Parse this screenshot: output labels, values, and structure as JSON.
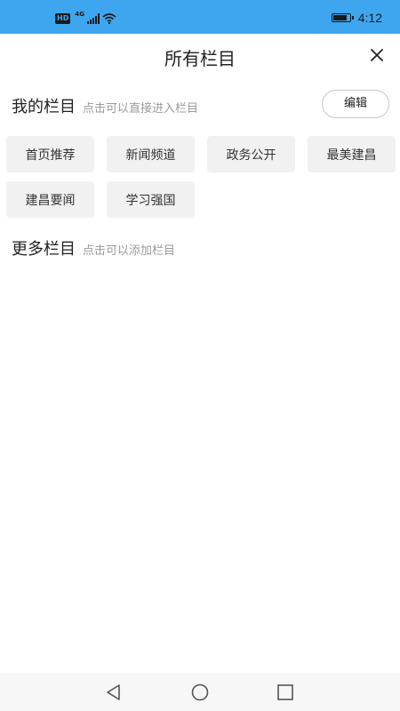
{
  "status_bar": {
    "hd_badge": "HD",
    "network_label": "4G",
    "time": "4:12",
    "battery_level": 0.9,
    "background_color": "#3ea6ee",
    "icons": [
      "signal-icon",
      "wifi-icon",
      "battery-icon"
    ]
  },
  "header": {
    "title": "所有栏目",
    "close_icon": "close-icon"
  },
  "my_channels": {
    "title": "我的栏目",
    "hint": "点击可以直接进入栏目",
    "edit_label": "编辑",
    "items": [
      {
        "label": "首页推荐"
      },
      {
        "label": "新闻频道"
      },
      {
        "label": "政务公开"
      },
      {
        "label": "最美建昌"
      },
      {
        "label": "建昌要闻"
      },
      {
        "label": "学习强国"
      }
    ]
  },
  "more_channels": {
    "title": "更多栏目",
    "hint": "点击可以添加栏目",
    "items": []
  },
  "nav_bar": {
    "icons": [
      "back-icon",
      "home-icon",
      "recents-icon"
    ]
  }
}
